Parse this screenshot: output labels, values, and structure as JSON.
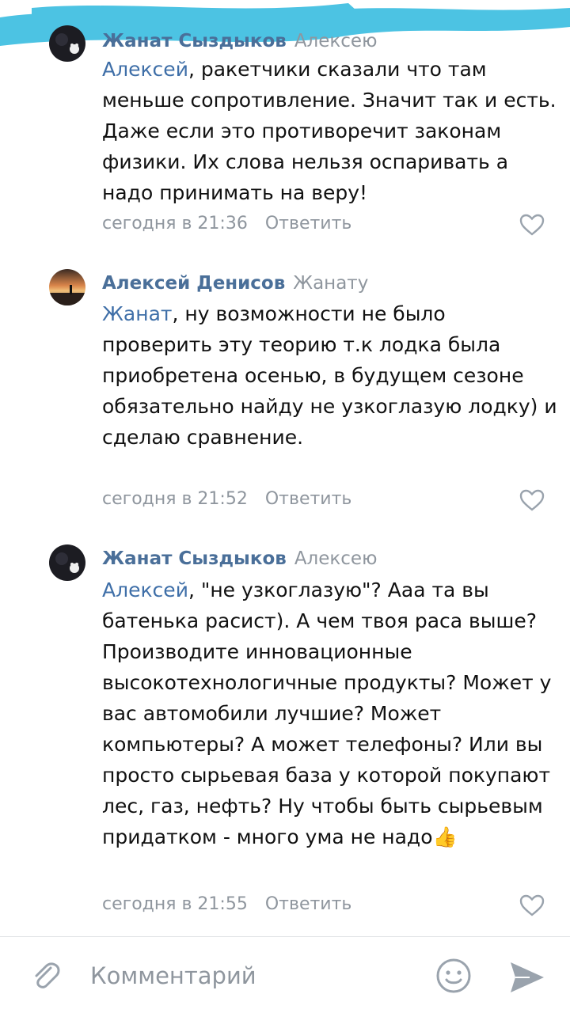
{
  "comments": [
    {
      "author": "Жанат Сыздыков",
      "reply_to": "Алексею",
      "mention": "Алексей",
      "text_rest": ", ракетчики сказали что там меньше сопротивление. Значит так и есть. Даже если это противоречит законам физики.  Их слова нельзя оспаривать а надо принимать на веру!",
      "time": "сегодня в 21:36",
      "reply_label": "Ответить"
    },
    {
      "author": "Алексей Денисов",
      "reply_to": "Жанату",
      "mention": "Жанат",
      "text_rest": ", ну возможности не было проверить эту теорию т.к лодка была приобретена осенью, в будущем сезоне обязательно найду не узкоглазую лодку) и сделаю сравнение.",
      "time": "сегодня в 21:52",
      "reply_label": "Ответить"
    },
    {
      "author": "Жанат Сыздыков",
      "reply_to": "Алексею",
      "mention": "Алексей",
      "text_rest": ", \"не узкоглазую\"? Ааа та вы батенька расист). А чем твоя раса выше? Производите инновационные высокотехнологичные продукты? Может у вас автомобили лучшие? Может компьютеры? А может телефоны? Или вы просто сырьевая база у которой покупают лес, газ, нефть? Ну чтобы быть сырьевым придатком - много ума не надо",
      "emoji": "👍",
      "time": "сегодня в 21:55",
      "reply_label": "Ответить"
    }
  ],
  "composer": {
    "placeholder": "Комментарий"
  },
  "colors": {
    "author": "#4a6f99",
    "mention": "#3f6fa8",
    "meta": "#8f969e",
    "scribble": "#4cc3e3"
  },
  "icons": [
    "paperclip-icon",
    "smile-icon",
    "send-icon",
    "heart-icon"
  ]
}
